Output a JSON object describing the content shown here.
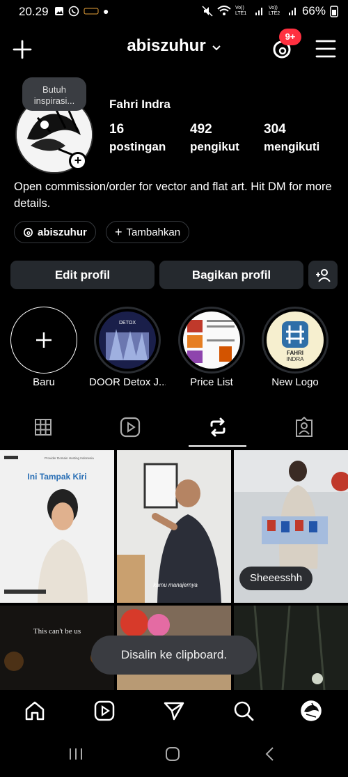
{
  "status_bar": {
    "time": "20.29",
    "battery": "66%",
    "net1": "Vo)) LTE1",
    "net2": "Vo)) LTE2"
  },
  "header": {
    "username": "abiszuhur",
    "notification_count": "9+"
  },
  "profile": {
    "name": "Fahri Indra",
    "note": "Butuh inspirasi...",
    "posts_count": "16",
    "posts_label": "postingan",
    "followers_count": "492",
    "followers_label": "pengikut",
    "following_count": "304",
    "following_label": "mengikuti",
    "bio": "Open commission/order for vector and flat art. Hit DM for more details.",
    "threads_handle": "abiszuhur",
    "add_label": "Tambahkan"
  },
  "actions": {
    "edit": "Edit profil",
    "share": "Bagikan profil"
  },
  "highlights": [
    {
      "label": "Baru"
    },
    {
      "label": "DOOR Detox J..."
    },
    {
      "label": "Price List"
    },
    {
      "label": "New Logo"
    }
  ],
  "highlight_text": {
    "detox": "DETOX",
    "logo_top": "FAHRI",
    "logo_bottom": "INDRA"
  },
  "grid": {
    "post1_header": "Provider Domain Hosting Indonesia",
    "post1_title": "Ini Tampak Kiri",
    "post2_caption": "kamu manajernya",
    "post3_pill": "Sheeesshh",
    "post4_text": "This can't be us"
  },
  "toast": "Disalin ke clipboard."
}
